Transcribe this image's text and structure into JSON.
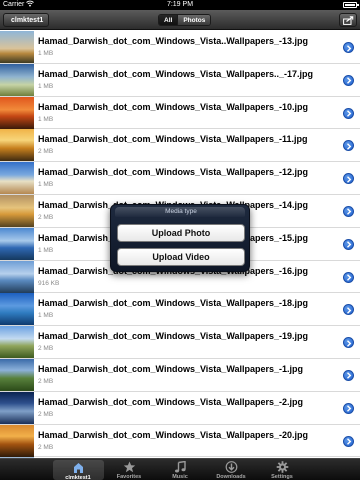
{
  "status_bar": {
    "carrier": "Carrier",
    "time": "7:19 PM",
    "battery_level": 0.95
  },
  "nav_bar": {
    "back_label": "clmktest1",
    "segments": [
      "All",
      "Photos"
    ],
    "selected_segment": "All",
    "share_icon": "share-icon"
  },
  "files": [
    {
      "name": "Hamad_Darwish_dot_com_Windows_Vista..Wallpapers_-13.jpg",
      "size": "1 MB"
    },
    {
      "name": "Hamad_Darwish_dot_com_Windows_Vista_Wallpapers.._-17.jpg",
      "size": "1 MB"
    },
    {
      "name": "Hamad_Darwish_dot_com_Windows_Vista_Wallpapers_-10.jpg",
      "size": "1 MB"
    },
    {
      "name": "Hamad_Darwish_dot_com_Windows_Vista_Wallpapers_-11.jpg",
      "size": "2 MB"
    },
    {
      "name": "Hamad_Darwish_dot_com_Windows_Vista_Wallpapers_-12.jpg",
      "size": "1 MB"
    },
    {
      "name": "Hamad_Darwish_dot_com_Windows_Vista_Wallpapers_-14.jpg",
      "size": "2 MB"
    },
    {
      "name": "Hamad_Darwish_dot_com_Windows_Vista_Wallpapers_-15.jpg",
      "size": "1 MB"
    },
    {
      "name": "Hamad_Darwish_dot_com_Windows_Vista_Wallpapers_-16.jpg",
      "size": "916 KB"
    },
    {
      "name": "Hamad_Darwish_dot_com_Windows_Vista_Wallpapers_-18.jpg",
      "size": "1 MB"
    },
    {
      "name": "Hamad_Darwish_dot_com_Windows_Vista_Wallpapers_-19.jpg",
      "size": "2 MB"
    },
    {
      "name": "Hamad_Darwish_dot_com_Windows_Vista_Wallpapers_-1.jpg",
      "size": "2 MB"
    },
    {
      "name": "Hamad_Darwish_dot_com_Windows_Vista_Wallpapers_-2.jpg",
      "size": "2 MB"
    },
    {
      "name": "Hamad_Darwish_dot_com_Windows_Vista_Wallpapers_-20.jpg",
      "size": "2 MB"
    },
    {
      "name": "Hamad_Darwish_dot_com_Windows_Vista_Wallpapers_-21.jpg",
      "size": "2 MB"
    }
  ],
  "media_popover": {
    "title": "Media type",
    "upload_photo": "Upload Photo",
    "upload_video": "Upload Video"
  },
  "tab_bar": {
    "tabs": [
      {
        "label": "clmktest1",
        "icon": "home-icon",
        "active": true
      },
      {
        "label": "Favorites",
        "icon": "star-icon",
        "active": false
      },
      {
        "label": "Music",
        "icon": "music-note-icon",
        "active": false
      },
      {
        "label": "Downloads",
        "icon": "download-icon",
        "active": false
      },
      {
        "label": "Settings",
        "icon": "gear-icon",
        "active": false
      }
    ]
  }
}
